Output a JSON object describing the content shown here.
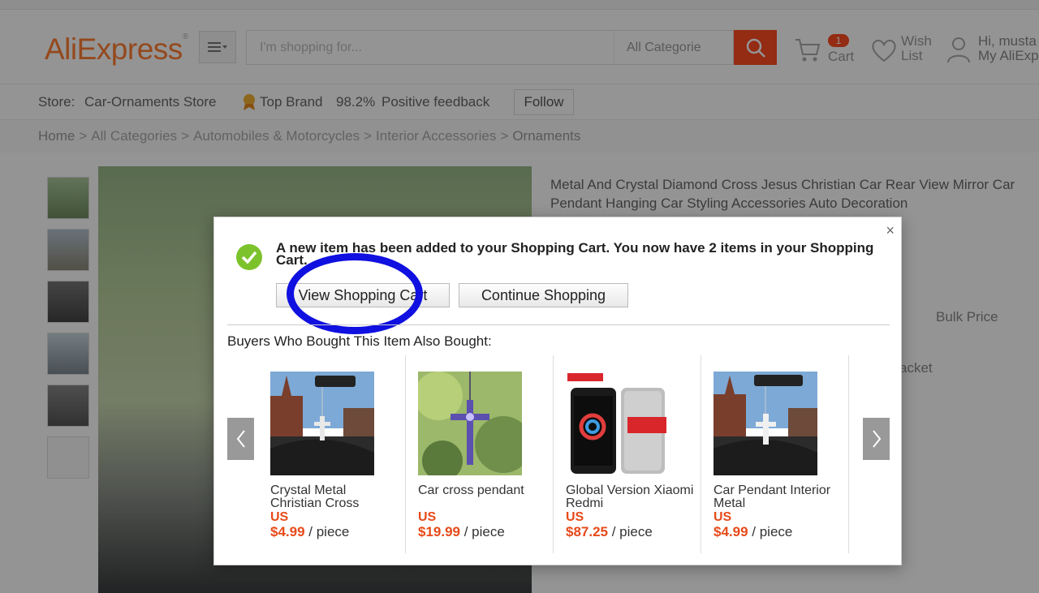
{
  "header": {
    "logo": "AliExpress",
    "logo_mark": "®",
    "search_placeholder": "I'm shopping for...",
    "category": "All Categorie",
    "cart_count": "1",
    "cart_label": "Cart",
    "wish_line1": "Wish",
    "wish_line2": "List",
    "account_line1": "Hi, musta",
    "account_line2": "My AliExp"
  },
  "store": {
    "label": "Store:",
    "name": "Car-Ornaments Store",
    "badge": "Top Brand",
    "feedback_pct": "98.2%",
    "feedback_label": "Positive feedback",
    "follow": "Follow"
  },
  "breadcrumb": {
    "home": "Home",
    "c1": "All Categories",
    "c2": "Automobiles & Motorcycles",
    "c3": "Interior Accessories",
    "c4": "Ornaments",
    "sep": ">"
  },
  "product": {
    "title": "Metal And Crystal Diamond Cross Jesus Christian Car Rear View Mirror Car Pendant Hanging Car Styling Accessories Auto Decoration",
    "bulk_price": "Bulk Price",
    "bracket": "acket"
  },
  "modal": {
    "close": "×",
    "message": "A new item has been added to your Shopping Cart. You now have 2 items in your Shopping Cart.",
    "view_cart": "View Shopping Cart",
    "continue": "Continue Shopping",
    "also_bought": "Buyers Who Bought This Item Also Bought:",
    "products": [
      {
        "name": "Crystal Metal Christian Cross",
        "currency": "US",
        "price": "$4.99",
        "unit": "/ piece"
      },
      {
        "name": "Car cross pendant",
        "currency": "US",
        "price": "$19.99",
        "unit": "/ piece"
      },
      {
        "name": "Global Version Xiaomi Redmi",
        "currency": "US",
        "price": "$87.25",
        "unit": "/ piece"
      },
      {
        "name": "Car Pendant Interior Metal",
        "currency": "US",
        "price": "$4.99",
        "unit": "/ piece"
      }
    ]
  },
  "colors": {
    "brand": "#ff7e33",
    "search_button": "#ff4b21",
    "price": "#e64a19",
    "annotation_ring": "#1010e0",
    "success": "#7cc22b"
  }
}
